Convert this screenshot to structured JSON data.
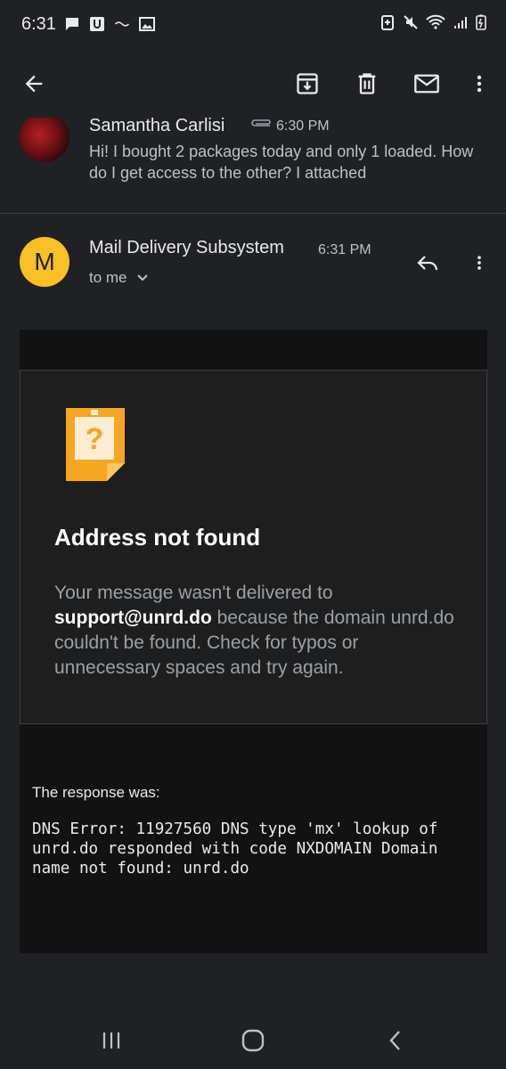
{
  "status_bar": {
    "time": "6:31",
    "icons_left": [
      "chat-icon",
      "u-app-icon",
      "tilde-icon",
      "image-icon"
    ],
    "icons_right": [
      "battery-saver-icon",
      "mute-icon",
      "wifi-icon",
      "signal-icon",
      "battery-icon"
    ]
  },
  "toolbar": {
    "icons": [
      "back-arrow-icon",
      "archive-icon",
      "trash-icon",
      "mail-unread-icon",
      "more-vert-icon"
    ]
  },
  "previous_message": {
    "sender": "Samantha Carlisi",
    "time": "6:30 PM",
    "snippet": "Hi! I bought 2 packages today and only 1 loaded. How do I get access to the other? I attached"
  },
  "message": {
    "avatar_letter": "M",
    "avatar_color": "#f6c026",
    "sender": "Mail Delivery Subsystem",
    "time": "6:31 PM",
    "recipient": "to me"
  },
  "bounce": {
    "title": "Address not found",
    "text_before": "Your message wasn't delivered to ",
    "address": "support@unrd.do",
    "text_after": " because the domain unrd.do couldn't be found. Check for typos or unnecessary spaces and try again.",
    "response_label": "The response was:",
    "response_text": "DNS Error: 11927560 DNS type 'mx' lookup of unrd.do responded with code NXDOMAIN Domain name not found: unrd.do",
    "icon_color": "#f6a623"
  },
  "nav_bar": {
    "icons": [
      "recent-apps-icon",
      "home-icon",
      "back-icon"
    ]
  }
}
